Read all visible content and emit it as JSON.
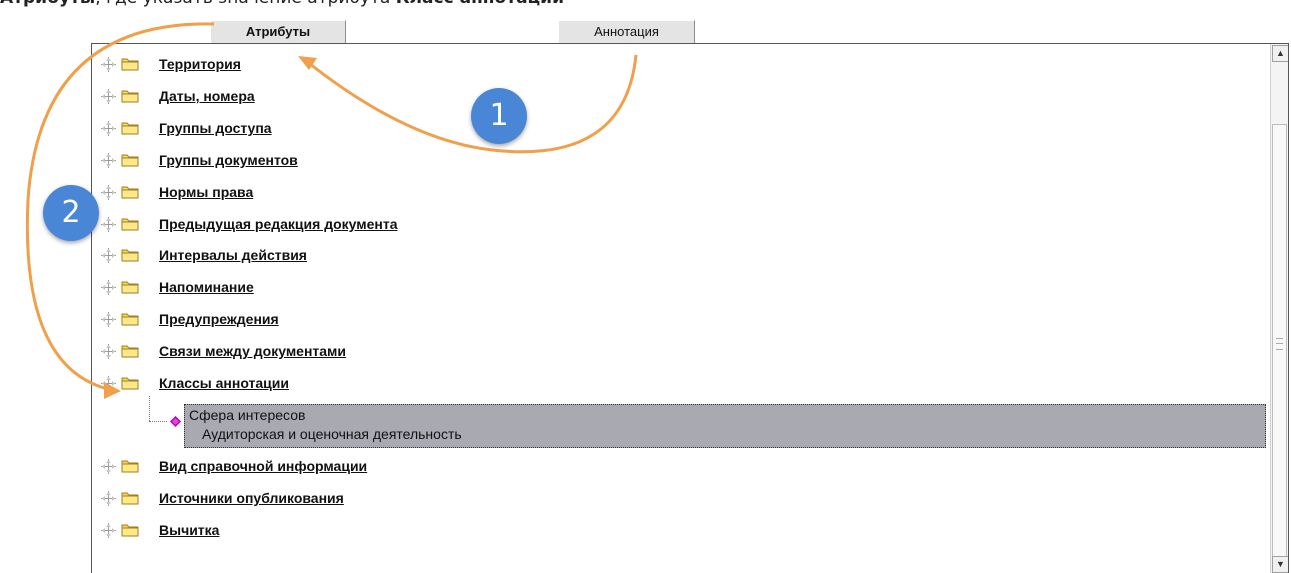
{
  "instruction": {
    "prefix": "Атрибуты",
    "middle": ", где указать значение атрибута ",
    "target": "Класс аннотации"
  },
  "tabs": {
    "attributes": "Атрибуты",
    "annotation": "Аннотация"
  },
  "tree": {
    "items": [
      {
        "label": "Территория"
      },
      {
        "label": "Даты, номера"
      },
      {
        "label": "Группы доступа"
      },
      {
        "label": "Группы документов"
      },
      {
        "label": "Нормы права"
      },
      {
        "label": "Предыдущая редакция документа"
      },
      {
        "label": "Интервалы действия"
      },
      {
        "label": "Напоминание"
      },
      {
        "label": "Предупреждения"
      },
      {
        "label": "Связи между документами"
      },
      {
        "label": "Классы аннотации"
      },
      {
        "label": "Вид справочной информации"
      },
      {
        "label": "Источники опубликования"
      },
      {
        "label": "Вычитка"
      }
    ],
    "selected_child": {
      "title": "Сфера интересов",
      "value": "Аудиторская и оценочная деятельность"
    }
  },
  "annotations": {
    "step1": "1",
    "step2": "2",
    "arrow_color": "#f0a04b",
    "badge_color": "#4a86d6"
  },
  "icons": {
    "expander": "expand-cross-icon",
    "folder": "folder-icon",
    "child": "diamond-icon",
    "scroll_up": "scroll-up-icon",
    "scroll_down": "scroll-down-icon"
  }
}
